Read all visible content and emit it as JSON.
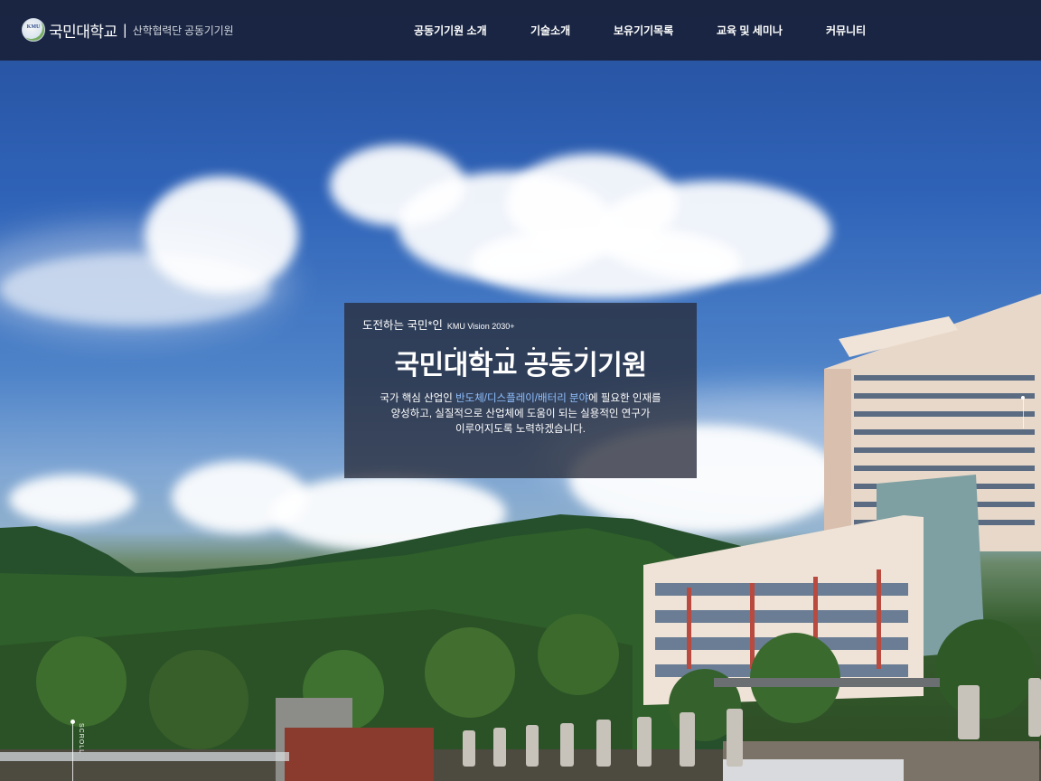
{
  "header": {
    "logo_mark": "KMU",
    "logo_name": "국민대학교",
    "logo_separator": "|",
    "logo_subtitle": "산학협력단 공동기기원"
  },
  "nav": {
    "items": [
      {
        "label": "공동기기원 소개"
      },
      {
        "label": "기술소개"
      },
      {
        "label": "보유기기목록"
      },
      {
        "label": "교육 및 세미나"
      },
      {
        "label": "커뮤니티"
      }
    ]
  },
  "hero": {
    "kicker": "도전하는 국민*인",
    "vision": "KMU Vision 2030+",
    "title": "국민대학교 공동기기원",
    "body_prefix": "국가 핵심 산업인 ",
    "body_highlight": "반도체/디스플레이/배터리 분야",
    "body_suffix": "에 필요한 인재를",
    "body_line2": "양성하고, 실질적으로 산업체에 도움이 되는 실용적인 연구가",
    "body_line3": "이루어지도록 노력하겠습니다."
  },
  "scroll": {
    "label": "SCROLL"
  },
  "colors": {
    "nav_bg": "#18223a",
    "highlight": "#8fc0ff"
  }
}
